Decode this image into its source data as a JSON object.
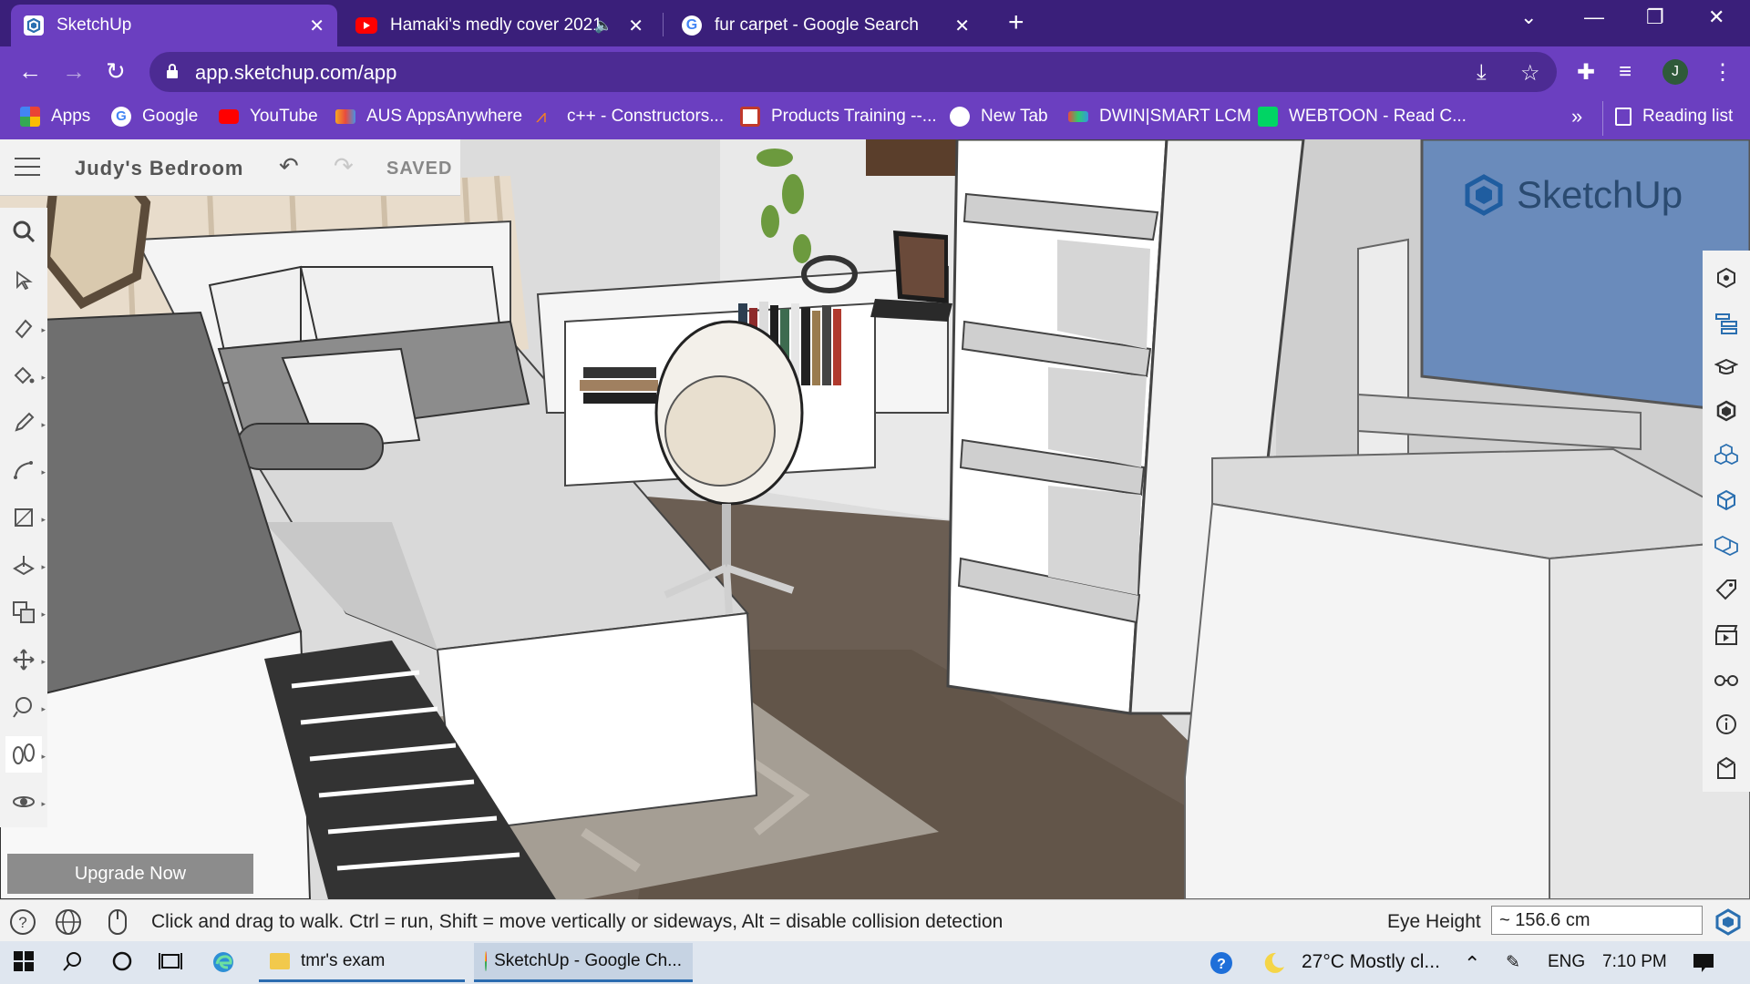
{
  "browser": {
    "tabs": [
      {
        "title": "SketchUp",
        "favicon": "sketchup-icon",
        "active": true
      },
      {
        "title": "Hamaki's medly cover 2021 |",
        "favicon": "youtube-icon",
        "muted_icon": "speaker-muted-icon"
      },
      {
        "title": "fur carpet - Google Search",
        "favicon": "google-icon"
      }
    ],
    "url": "app.sketchup.com/app",
    "profile_initial": "J",
    "bookmarks": [
      {
        "label": "Apps",
        "icon": "apps-grid-icon"
      },
      {
        "label": "Google",
        "icon": "google-icon"
      },
      {
        "label": "YouTube",
        "icon": "youtube-icon"
      },
      {
        "label": "AUS AppsAnywhere",
        "icon": "apps-anywhere-icon"
      },
      {
        "label": "c++ - Constructors...",
        "icon": "stack-overflow-icon"
      },
      {
        "label": "Products Training --...",
        "icon": "training-icon"
      },
      {
        "label": "New Tab",
        "icon": "globe-icon"
      },
      {
        "label": "DWIN|SMART LCM",
        "icon": "dwin-icon"
      },
      {
        "label": "WEBTOON - Read C...",
        "icon": "webtoon-icon"
      }
    ],
    "bookmarks_overflow": "»",
    "reading_list": "Reading list"
  },
  "app": {
    "model_title": "Judy's Bedroom",
    "save_status": "SAVED",
    "upgrade_label": "Upgrade Now",
    "logo_text": "SketchUp",
    "status_hint": "Click and drag to walk. Ctrl = run, Shift = move vertically or sideways, Alt = disable collision detection",
    "eye_height_label": "Eye Height",
    "eye_height_value": "~ 156.6 cm",
    "left_tools": [
      "search-icon",
      "select-icon",
      "eraser-icon",
      "paint-bucket-icon",
      "pencil-icon",
      "arc-icon",
      "rectangle-icon",
      "push-pull-icon",
      "offset-icon",
      "move-icon",
      "orbit-look-icon",
      "walk-icon",
      "orbit-icon"
    ],
    "active_tool": "walk-icon",
    "right_tools": [
      "entity-info-icon",
      "outliner-icon",
      "instructor-icon",
      "components-icon",
      "materials-icon",
      "styles-icon",
      "layers-icon",
      "scenes-icon",
      "animation-icon",
      "display-icon",
      "info-icon",
      "export-icon"
    ]
  },
  "taskbar": {
    "apps": [
      {
        "label": "tmr's exam",
        "icon": "folder-icon"
      },
      {
        "label": "SketchUp - Google Ch...",
        "icon": "chrome-icon"
      }
    ],
    "weather": "27°C  Mostly cl...",
    "language": "ENG",
    "time": "7:10 PM"
  },
  "colors": {
    "tabstrip": "#3a1f7a",
    "chrome": "#6b3fc0",
    "accent": "#2a6fb0"
  }
}
